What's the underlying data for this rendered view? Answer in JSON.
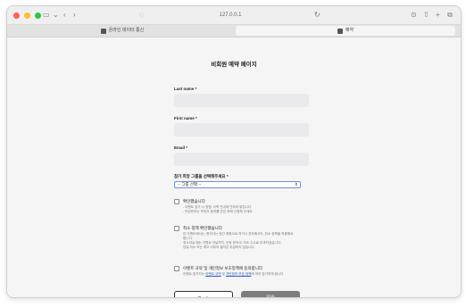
{
  "browser": {
    "url": "127.0.0.1",
    "tabs": [
      {
        "label": "온라인 데이터 통신"
      },
      {
        "label": "예약"
      }
    ]
  },
  "page": {
    "title": "비회원 예약 페이지"
  },
  "form": {
    "last_name_label": "Last name *",
    "first_name_label": "First name *",
    "email_label": "Email *",
    "group_label": "참가 희망 그룹을 선택해주세요 *",
    "group_selected": "-- 그룹 선택 --",
    "checks": [
      {
        "title": "확인했습니다",
        "desc": [
          "- 이벤트 참가 시 정원, 이력 안내에 관하여 알립니다.",
          "- 미성년자는 보호자 동의를 받은 후에 신청해 주세요."
        ]
      },
      {
        "title": "취소 정책 확인했습니다",
        "desc": [
          "본 이벤트에서는, 환자서는 참관 종합으로 하거나 취득해서도, 취소 정책을 적용해요",
          "합니다.",
          "취소하실 때는 이벤트 전날까지, 신청 문의서, 취소 수수료 부과되었습니다.",
          "당일 취소 또는 예고 이외의 결석은 취급하지 않습니다."
        ]
      },
      {
        "title": "이벤트 규약 및 개인정보 보호정책에 동의합니다",
        "desc_prefix": "이벤트 참가자는 ",
        "link1": "이벤트 규약",
        "desc_middle": " 및 ",
        "link2": "개인정보 보호 정책",
        "desc_suffix": "에 따라 참가하게 됩니다."
      }
    ],
    "back_label": "Back",
    "submit_label": "전송"
  },
  "colors": {
    "close": "#ff5f57",
    "minimize": "#febc2e",
    "maximize": "#28c840",
    "select_border": "#6a8ed8",
    "submit_bg": "#7d7d7d"
  },
  "icons": [
    "sidebar-icon",
    "chevron-left-icon",
    "chevron-right-icon",
    "shield-icon",
    "reload-icon",
    "download-icon",
    "share-icon",
    "new-tab-icon",
    "tab-overview-icon"
  ]
}
